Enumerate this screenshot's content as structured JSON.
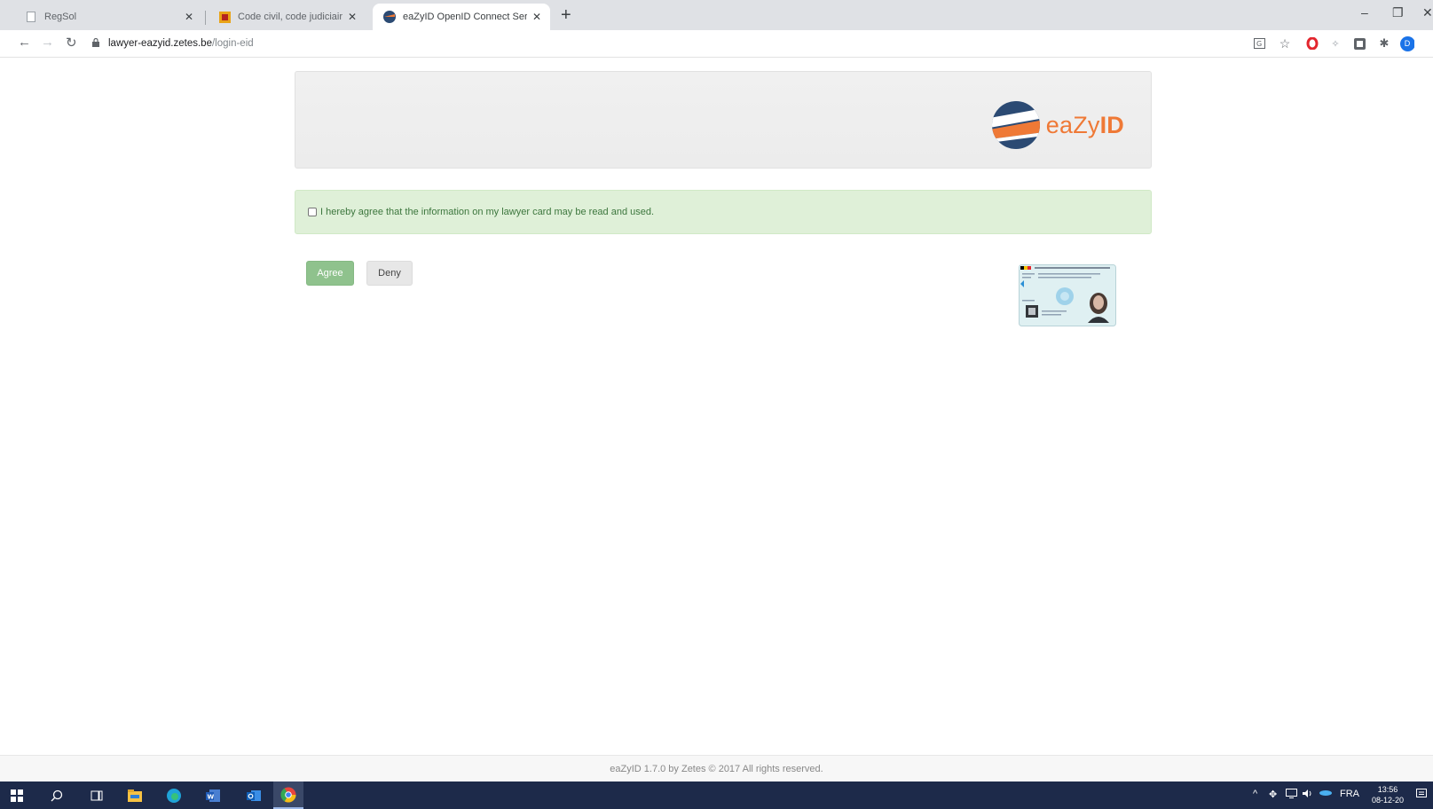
{
  "browser": {
    "tabs": [
      {
        "title": "RegSol",
        "active": false
      },
      {
        "title": "Code civil, code judiciaire, code p",
        "active": false
      },
      {
        "title": "eaZyID OpenID Connect Server-L",
        "active": true
      }
    ],
    "new_tab_label": "+",
    "window_controls": {
      "minimize": "–",
      "restore": "❐",
      "close": "✕"
    },
    "url": {
      "host": "lawyer-eazyid.zetes.be",
      "path": "/login-eid"
    },
    "profile_initial": "D"
  },
  "page": {
    "logo": {
      "text_light": "eaZy",
      "text_bold": "ID",
      "accent_color": "#ef7936",
      "dark_color": "#2b4a73"
    },
    "consent_text": "I hereby agree that the information on my lawyer card may be read and used.",
    "consent_checked": false,
    "buttons": {
      "agree": "Agree",
      "deny": "Deny"
    },
    "footer": "eaZyID 1.7.0 by Zetes © 2017 All rights reserved."
  },
  "taskbar": {
    "language": "FRA",
    "time": "13:56",
    "date": "08-12-20"
  },
  "colors": {
    "success_bg": "#dff0d8",
    "success_text": "#3c763d",
    "agree_button": "#8fc28d",
    "taskbar": "#1d2a4a"
  }
}
